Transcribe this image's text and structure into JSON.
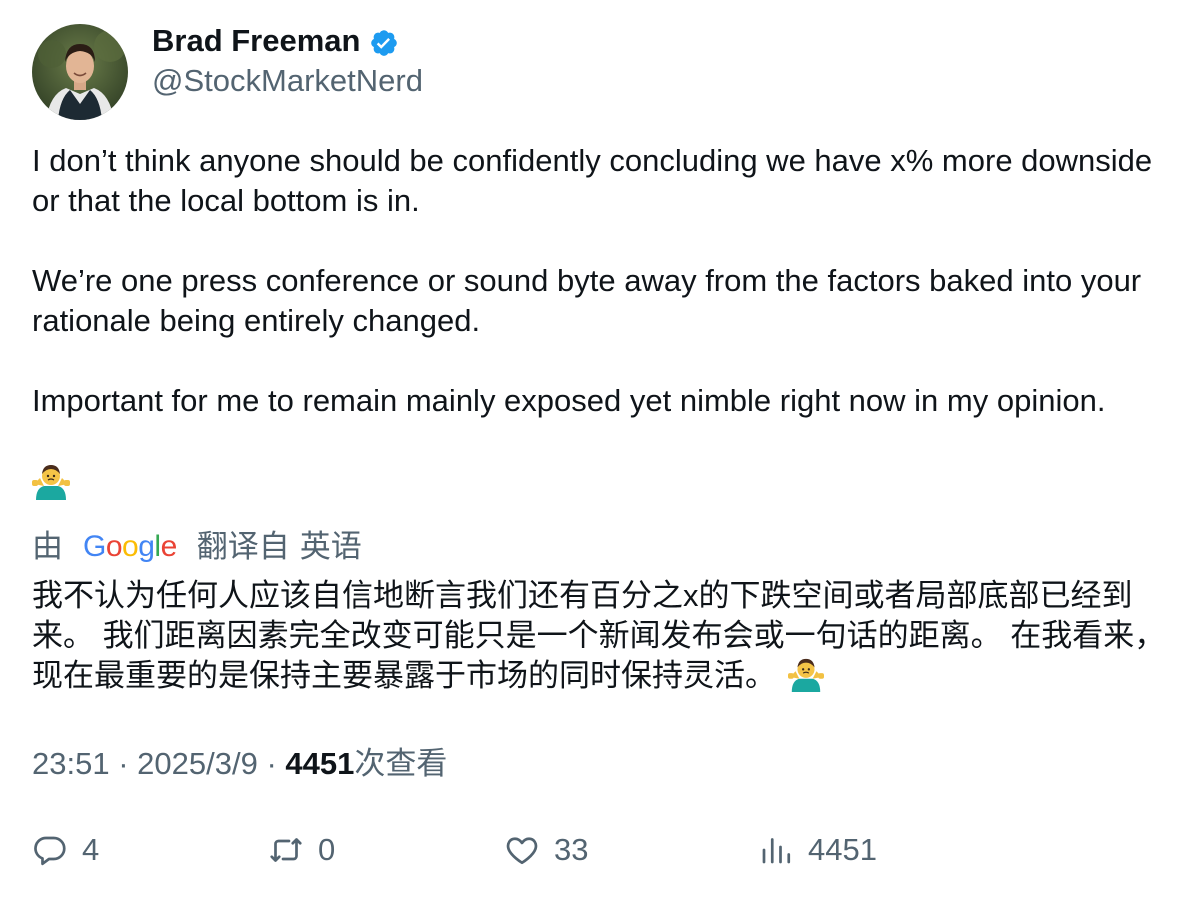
{
  "author": {
    "name": "Brad Freeman",
    "handle": "@StockMarketNerd",
    "verified": true
  },
  "tweet": {
    "paragraphs": [
      "I don’t think anyone should be confidently concluding we have x% more downside or that the local bottom is in.",
      "We’re one press conference or sound byte away from the factors baked into your rationale being entirely changed.",
      "Important for me to remain mainly exposed yet nimble right now in my opinion."
    ],
    "emoji": "person-shrugging"
  },
  "translation": {
    "prefix": "由",
    "provider": "Google",
    "suffix": "翻译自",
    "language": "英语",
    "text": "我不认为任何人应该自信地断言我们还有百分之x的下跌空间或者局部底部已经到来。 我们距离因素完全改变可能只是一个新闻发布会或一句话的距离。 在我看来，现在最重要的是保持主要暴露于市场的同时保持灵活。"
  },
  "meta": {
    "time": "23:51",
    "date": "2025/3/9",
    "separator": "·",
    "views_count": "4451",
    "views_label": "次查看"
  },
  "actions": {
    "replies": "4",
    "reposts": "0",
    "likes": "33",
    "views": "4451"
  },
  "colors": {
    "text": "#0f1419",
    "secondary": "#536471",
    "verified": "#1d9bf0"
  }
}
